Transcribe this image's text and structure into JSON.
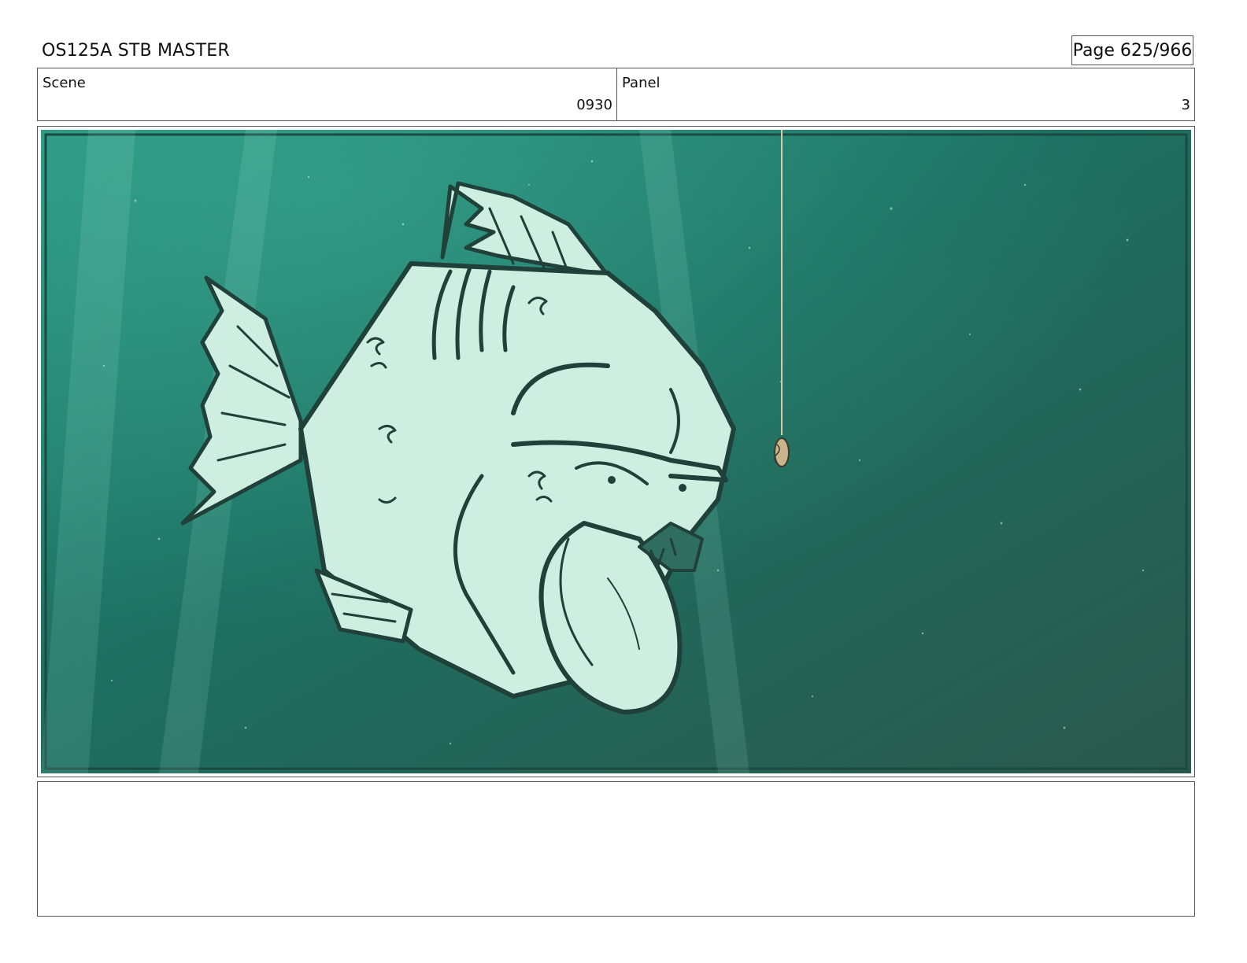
{
  "header": {
    "title": "OS125A  STB MASTER",
    "page": "Page 625/966"
  },
  "scene": {
    "label": "Scene",
    "value": "0930"
  },
  "panel": {
    "label": "Panel",
    "value": "3"
  },
  "notes": {
    "text": ""
  },
  "artwork": {
    "background_color": "#1f6b5d",
    "fish_fill_color": "#cdeee0",
    "line_color": "#20403a"
  }
}
